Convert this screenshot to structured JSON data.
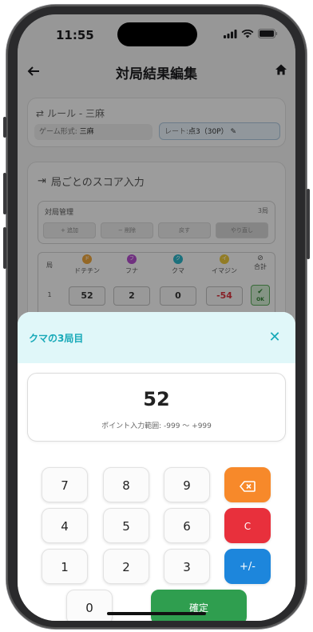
{
  "status": {
    "time": "11:55"
  },
  "appbar": {
    "title": "対局結果編集"
  },
  "rule": {
    "title": "ルール - 三麻",
    "game_type_label": "ゲーム形式:",
    "game_type_value": "三麻",
    "rate_label": "レート:",
    "rate_value": "点3（30P）"
  },
  "score": {
    "title": "局ごとのスコア入力",
    "management_title": "対局管理",
    "round_count": "3局",
    "buttons": [
      "+ 追加",
      "− 削除",
      "戻す",
      "やり直し"
    ],
    "columns": [
      "局",
      "ドテチン",
      "フナ",
      "クマ",
      "イマジン",
      "合計"
    ],
    "avatars": [
      "ド",
      "フ",
      "ク",
      "イ"
    ],
    "avatar_colors": [
      "#e8a23a",
      "#b04bc9",
      "#2ab0c2",
      "#e4c33a"
    ],
    "row1": {
      "index": "1",
      "values": [
        "52",
        "2",
        "0",
        "-54"
      ],
      "total": "OK"
    }
  },
  "sheet": {
    "title": "クマの3局目",
    "value": "52",
    "range_hint": "ポイント入力範囲: -999 〜 +999",
    "keys": [
      "7",
      "8",
      "9",
      "4",
      "5",
      "6",
      "1",
      "2",
      "3",
      "0"
    ],
    "clear_label": "C",
    "sign_label": "+/-",
    "confirm_label": "確定"
  },
  "colors": {
    "accent": "#17a9b8",
    "backspace": "#f7892a",
    "clear": "#e8303c",
    "sign": "#1d86dc",
    "confirm": "#2f9e4f"
  }
}
